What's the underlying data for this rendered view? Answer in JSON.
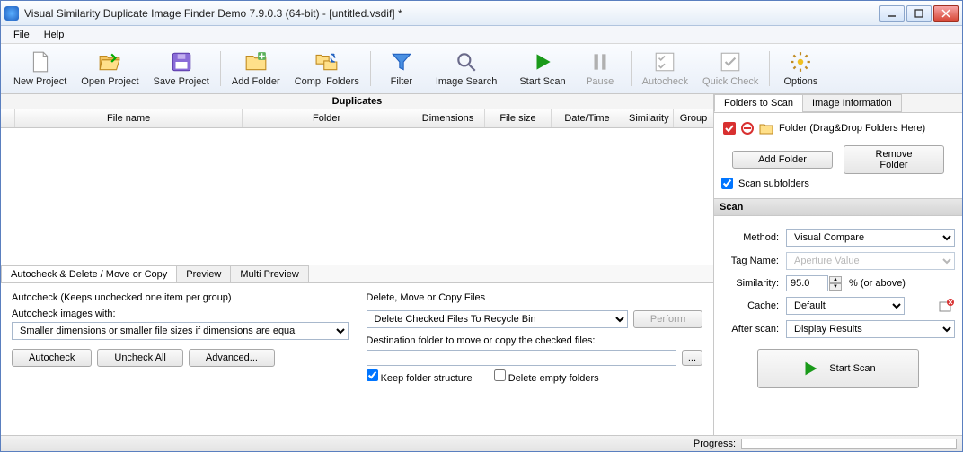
{
  "window": {
    "title": "Visual Similarity Duplicate Image Finder Demo 7.9.0.3 (64-bit) - [untitled.vsdif] *"
  },
  "menubar": {
    "file": "File",
    "help": "Help"
  },
  "toolbar": {
    "new_project": "New Project",
    "open_project": "Open Project",
    "save_project": "Save Project",
    "add_folder": "Add Folder",
    "comp_folders": "Comp. Folders",
    "filter": "Filter",
    "image_search": "Image Search",
    "start_scan": "Start Scan",
    "pause": "Pause",
    "autocheck": "Autocheck",
    "quick_check": "Quick Check",
    "options": "Options"
  },
  "duplicates": {
    "title": "Duplicates",
    "columns": [
      "File name",
      "Folder",
      "Dimensions",
      "File size",
      "Date/Time",
      "Similarity",
      "Group"
    ]
  },
  "bottom_tabs": {
    "t1": "Autocheck & Delete / Move or Copy",
    "t2": "Preview",
    "t3": "Multi Preview"
  },
  "autocheck_panel": {
    "hint": "Autocheck (Keeps unchecked one item per group)",
    "images_with_label": "Autocheck images with:",
    "criteria": "Smaller dimensions or smaller file sizes if dimensions are equal",
    "btn_autocheck": "Autocheck",
    "btn_uncheck": "Uncheck All",
    "btn_advanced": "Advanced..."
  },
  "action_panel": {
    "title": "Delete, Move or Copy Files",
    "action": "Delete Checked Files To Recycle Bin",
    "perform": "Perform",
    "dest_label": "Destination folder to move or copy the checked files:",
    "dest_value": "",
    "keep_structure": "Keep folder structure",
    "delete_empty": "Delete empty folders"
  },
  "right_tabs": {
    "folders": "Folders to Scan",
    "info": "Image Information"
  },
  "folders": {
    "placeholder": "Folder (Drag&Drop Folders Here)",
    "add": "Add Folder",
    "remove": "Remove Folder",
    "scan_sub": "Scan subfolders"
  },
  "scan": {
    "header": "Scan",
    "method_label": "Method:",
    "method": "Visual Compare",
    "tag_label": "Tag Name:",
    "tag": "Aperture Value",
    "sim_label": "Similarity:",
    "sim_value": "95.0",
    "sim_suffix": "%   (or above)",
    "cache_label": "Cache:",
    "cache": "Default",
    "after_label": "After scan:",
    "after": "Display Results",
    "start": "Start Scan"
  },
  "status": {
    "progress_label": "Progress:"
  }
}
